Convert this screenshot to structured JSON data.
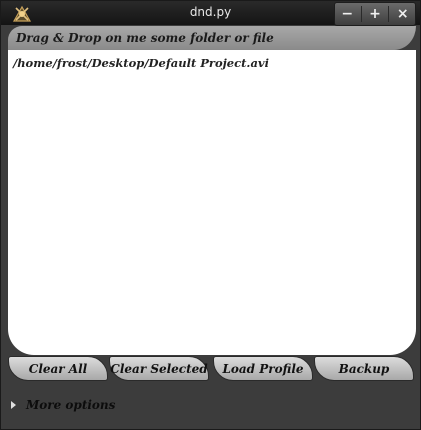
{
  "window": {
    "title": "dnd.py",
    "controls": {
      "minimize": "−",
      "maximize": "+",
      "close": "×"
    },
    "app_icon": "blender-style-app-icon"
  },
  "drop_area": {
    "header": "Drag & Drop on me some folder or file",
    "items": [
      "/home/frost/Desktop/Default Project.avi"
    ]
  },
  "buttons": {
    "clear_all": "Clear All",
    "clear_selected": "Clear Selected",
    "load_profile": "Load Profile",
    "backup": "Backup"
  },
  "expander": {
    "label": "More options",
    "icon": "triangle-right-icon"
  }
}
